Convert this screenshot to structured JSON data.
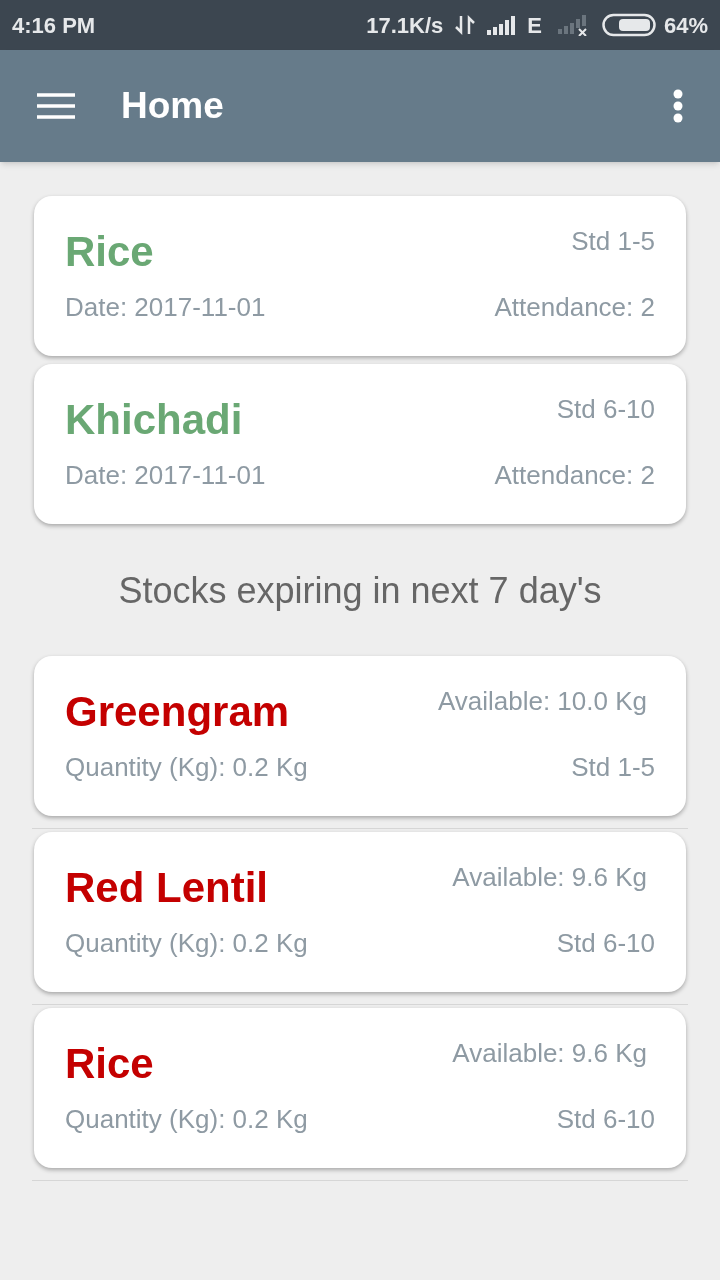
{
  "status_bar": {
    "time": "4:16 PM",
    "speed": "17.1K/s",
    "network": "E",
    "battery": "64%"
  },
  "app_bar": {
    "title": "Home"
  },
  "meals": [
    {
      "name": "Rice",
      "standard": "Std 1-5",
      "date": "Date: 2017-11-01",
      "attendance": "Attendance: 2"
    },
    {
      "name": "Khichadi",
      "standard": "Std 6-10",
      "date": "Date: 2017-11-01",
      "attendance": "Attendance: 2"
    }
  ],
  "stocks_heading": "Stocks expiring in next 7 day's",
  "stocks": [
    {
      "name": "Greengram",
      "available": "Available: 10.0 Kg",
      "quantity": "Quantity (Kg): 0.2 Kg",
      "standard": "Std 1-5"
    },
    {
      "name": "Red Lentil",
      "available": "Available: 9.6 Kg",
      "quantity": "Quantity (Kg): 0.2 Kg",
      "standard": "Std 6-10"
    },
    {
      "name": "Rice",
      "available": "Available: 9.6 Kg",
      "quantity": "Quantity (Kg): 0.2 Kg",
      "standard": "Std 6-10"
    }
  ]
}
